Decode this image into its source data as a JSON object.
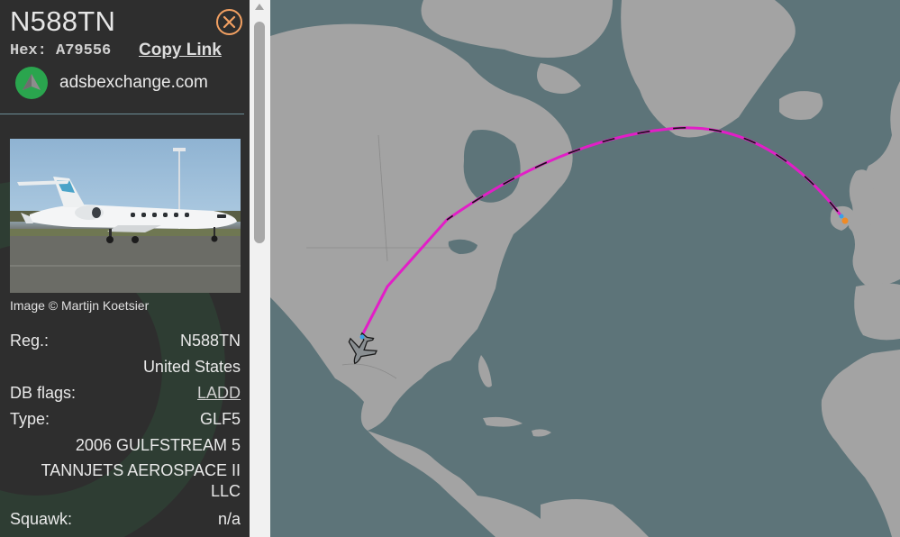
{
  "aircraft": {
    "registration_title": "N588TN",
    "hex_label": "Hex:",
    "hex_value": "A79556",
    "copy_link": "Copy Link"
  },
  "source": {
    "site": "adsbexchange.com",
    "logo_icon": "adsbx-logo-icon"
  },
  "photo": {
    "credit": "Image © Martijn Koetsier"
  },
  "details": {
    "reg_label": "Reg.:",
    "reg_value": "N588TN",
    "country": "United States",
    "db_flags_label": "DB flags:",
    "db_flags_value": "LADD",
    "type_label": "Type:",
    "type_value": "GLF5",
    "description": "2006 GULFSTREAM 5",
    "owner": "TANNJETS AEROSPACE II LLC",
    "squawk_label": "Squawk:",
    "squawk_value": "n/a"
  },
  "icons": {
    "close": "close-icon",
    "aircraft": "aircraft-icon"
  },
  "colors": {
    "track_primary": "#e21ec7",
    "track_secondary": "#111111",
    "close_accent": "#f2a062",
    "logo_green": "#2aa54e",
    "land": "#a2a2a2",
    "water": "#5d7479"
  }
}
